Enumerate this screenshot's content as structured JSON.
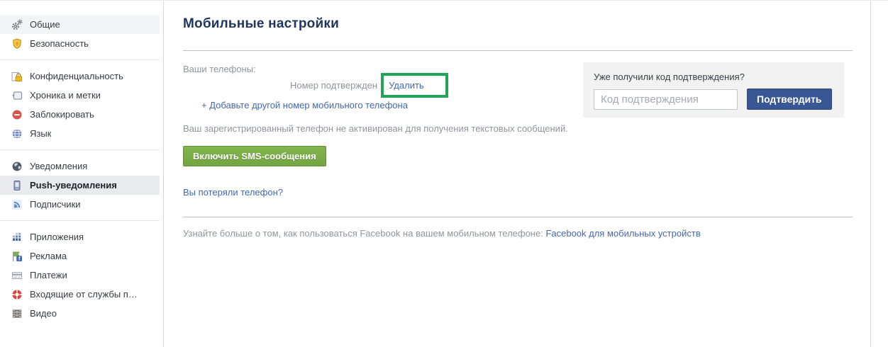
{
  "sidebar": {
    "sections": [
      {
        "items": [
          {
            "label": "Общие",
            "icon": "gears-icon"
          },
          {
            "label": "Безопасность",
            "icon": "shield-icon"
          }
        ]
      },
      {
        "items": [
          {
            "label": "Конфиденциальность",
            "icon": "lock-icon"
          },
          {
            "label": "Хроника и метки",
            "icon": "timeline-icon"
          },
          {
            "label": "Заблокировать",
            "icon": "block-icon"
          },
          {
            "label": "Язык",
            "icon": "language-globe-icon"
          }
        ]
      },
      {
        "items": [
          {
            "label": "Уведомления",
            "icon": "notifications-globe-icon"
          },
          {
            "label": "Push-уведомления",
            "icon": "mobile-phone-icon",
            "selected": true
          },
          {
            "label": "Подписчики",
            "icon": "followers-rss-icon"
          }
        ]
      },
      {
        "items": [
          {
            "label": "Приложения",
            "icon": "apps-grid-icon"
          },
          {
            "label": "Реклама",
            "icon": "adverts-icon"
          },
          {
            "label": "Платежи",
            "icon": "payments-card-icon"
          },
          {
            "label": "Входящие от службы п…",
            "icon": "support-lifebuoy-icon"
          },
          {
            "label": "Видео",
            "icon": "video-filmstrip-icon"
          }
        ]
      }
    ]
  },
  "main": {
    "title": "Мобильные настройки",
    "phones_label": "Ваши телефоны:",
    "number_status": "Номер подтвержден",
    "remove_link": "Удалить",
    "add_number_link": "+ Добавьте другой номер мобильного телефона",
    "sms_notice": "Ваш зарегистрированный телефон не активирован для получения текстовых сообщений.",
    "enable_sms_button": "Включить SMS-сообщения",
    "lost_phone_link": "Вы потеряли телефон?",
    "footer_text": "Узнайте больше о том, как пользоваться Facebook на вашем мобильном телефоне: ",
    "footer_link": "Facebook для мобильных устройств"
  },
  "confirm_panel": {
    "title": "Уже получили код подтверждения?",
    "input_placeholder": "Код подтверждения",
    "input_value": "",
    "confirm_button": "Подтвердить"
  },
  "colors": {
    "annotation_green": "#23a558",
    "link_blue": "#4267b2",
    "title_navy": "#1f355e",
    "enable_sms_green": "#79ad46",
    "confirm_blue": "#3a5795",
    "muted_gray": "#90949c",
    "selected_row_bg": "#e9eaed",
    "panel_bg": "#f2f2f2"
  }
}
